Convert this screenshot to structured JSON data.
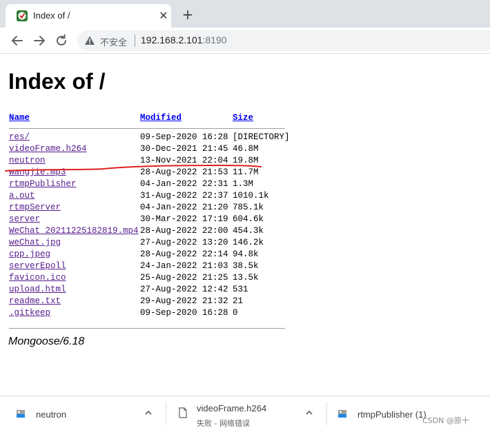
{
  "browser": {
    "tab_title": "Index of /",
    "tab_close_glyph": "✕",
    "new_tab_glyph": "+",
    "security_label": "不安全",
    "url_host": "192.168.2.101",
    "url_port": ":8190",
    "icons": [
      "favicon-icon",
      "close-icon",
      "plus-icon",
      "back-icon",
      "forward-icon",
      "reload-icon",
      "warning-icon"
    ]
  },
  "page": {
    "title": "Index of /",
    "columns": {
      "name": "Name",
      "modified": "Modified",
      "size": "Size"
    },
    "files": [
      {
        "name": "res/",
        "modified": "09-Sep-2020 16:28",
        "size": "[DIRECTORY]",
        "visited": true
      },
      {
        "name": "videoFrame.h264",
        "modified": "30-Dec-2021 21:45",
        "size": "46.8M",
        "visited": true
      },
      {
        "name": "neutron",
        "modified": "13-Nov-2021 22:04",
        "size": "19.8M",
        "visited": true
      },
      {
        "name": "wangjie.mp3",
        "modified": "28-Aug-2022 21:53",
        "size": "11.7M",
        "visited": true
      },
      {
        "name": "rtmpPublisher",
        "modified": "04-Jan-2022 22:31",
        "size": "1.3M",
        "visited": true
      },
      {
        "name": "a.out",
        "modified": "31-Aug-2022 22:37",
        "size": "1010.1k",
        "visited": true
      },
      {
        "name": "rtmpServer",
        "modified": "04-Jan-2022 21:20",
        "size": "785.1k",
        "visited": true
      },
      {
        "name": "server",
        "modified": "30-Mar-2022 17:19",
        "size": "604.6k",
        "visited": true
      },
      {
        "name": "WeChat_20211225182819.mp4",
        "modified": "28-Aug-2022 22:00",
        "size": "454.3k",
        "visited": true
      },
      {
        "name": "weChat.jpg",
        "modified": "27-Aug-2022 13:20",
        "size": "146.2k",
        "visited": true
      },
      {
        "name": "cpp.jpeg",
        "modified": "28-Aug-2022 22:14",
        "size": "94.8k",
        "visited": true
      },
      {
        "name": "serverEpoll",
        "modified": "24-Jan-2022 21:03",
        "size": "38.5k",
        "visited": true
      },
      {
        "name": "favicon.ico",
        "modified": "25-Aug-2022 21:25",
        "size": "13.5k",
        "visited": true
      },
      {
        "name": "upload.html",
        "modified": "27-Aug-2022 12:42",
        "size": "531",
        "visited": true
      },
      {
        "name": "readme.txt",
        "modified": "29-Aug-2022 21:32",
        "size": "21",
        "visited": true
      },
      {
        "name": ".gitkeep",
        "modified": "09-Sep-2020 16:28",
        "size": "0",
        "visited": true
      }
    ],
    "server_signature": "Mongoose/6.18",
    "annotation_color": "#e02020"
  },
  "downloads": [
    {
      "name": "neutron",
      "status": ""
    },
    {
      "name": "videoFrame.h264",
      "status": "失败 - 网络错误"
    },
    {
      "name": "rtmpPublisher (1)",
      "status": ""
    }
  ],
  "watermark": "CSDN @原十"
}
